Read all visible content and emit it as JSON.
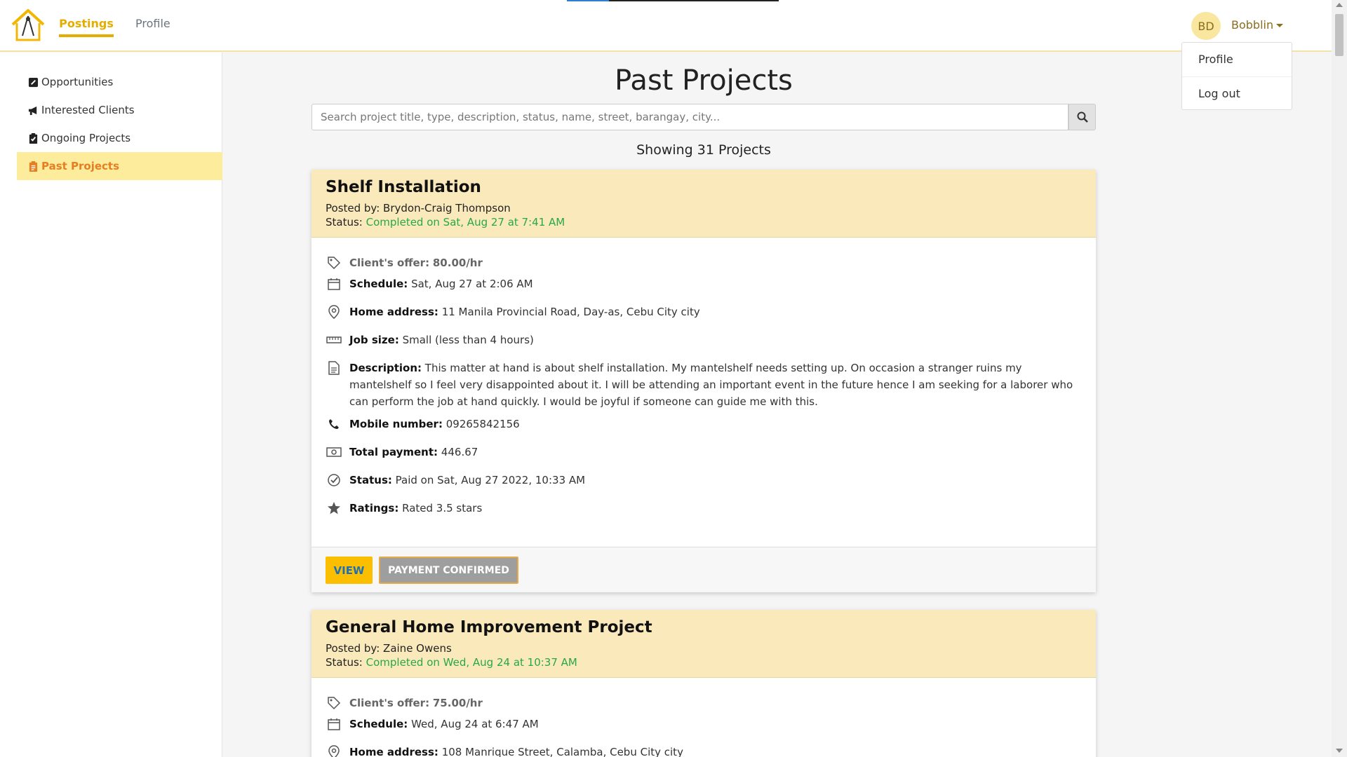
{
  "nav": {
    "postings": "Postings",
    "profile": "Profile",
    "avatar_initials": "BD",
    "username": "Bobblin",
    "dropdown": [
      "Profile",
      "Log out"
    ]
  },
  "sidebar": {
    "items": [
      {
        "label": "Opportunities",
        "icon": "edit-square-icon"
      },
      {
        "label": "Interested Clients",
        "icon": "megaphone-icon"
      },
      {
        "label": "Ongoing Projects",
        "icon": "clipboard-check-icon"
      },
      {
        "label": "Past Projects",
        "icon": "clipboard-list-icon",
        "active": true
      }
    ]
  },
  "main": {
    "title": "Past Projects",
    "search_placeholder": "Search project title, type, description, status, name, street, barangay, city...",
    "count_text": "Showing 31 Projects"
  },
  "labels": {
    "offer": "Client's offer:",
    "schedule": "Schedule:",
    "address": "Home address:",
    "job_size": "Job size:",
    "description": "Description:",
    "mobile": "Mobile number:",
    "total": "Total payment:",
    "status": "Status:",
    "ratings": "Ratings:",
    "posted_by": "Posted by:",
    "status_head": "Status:"
  },
  "cards": [
    {
      "title": "Shelf Installation",
      "posted_by": "Brydon-Craig Thompson",
      "status": "Completed on Sat, Aug 27 at 7:41 AM",
      "offer": "80.00/hr",
      "schedule": "Sat, Aug 27 at 2:06 AM",
      "address": "11 Manila Provincial Road, Day-as, Cebu City city",
      "job_size": "Small (less than 4 hours)",
      "description": "This matter at hand is about shelf installation. My mantelshelf needs setting up. On occasion a stranger ruins my mantelshelf so I feel very disappointed about it. I will be attending an important event in the future hence I am seeking for a laborer who can perform the job at hand quickly. I would be joyful if someone can guide me with this.",
      "mobile": "09265842156",
      "total": "446.67",
      "payment_status": "Paid on Sat, Aug 27 2022, 10:33 AM",
      "ratings": "Rated 3.5 stars",
      "view_label": "VIEW",
      "paid_label": "PAYMENT CONFIRMED"
    },
    {
      "title": "General Home Improvement Project",
      "posted_by": "Zaine Owens",
      "status": "Completed on Wed, Aug 24 at 10:37 AM",
      "offer": "75.00/hr",
      "schedule": "Wed, Aug 24 at 6:47 AM",
      "address": "108 Manrique Street, Calamba, Cebu City city"
    }
  ]
}
